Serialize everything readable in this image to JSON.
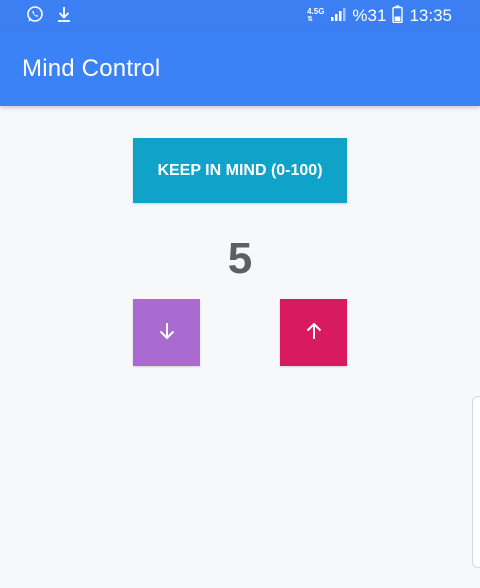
{
  "status_bar": {
    "left_icons": [
      "whatsapp-icon",
      "download-icon"
    ],
    "network_type": "4.5G",
    "battery_text": "%31",
    "time": "13:35"
  },
  "app_bar": {
    "title": "Mind Control",
    "color": "#3b82f6"
  },
  "main": {
    "keep_button_label": "KEEP IN MIND (0-100)",
    "keep_button_color": "#0fa3c9",
    "value": "5",
    "down_button": {
      "icon": "arrow-down-icon",
      "color": "#aa6bd0"
    },
    "up_button": {
      "icon": "arrow-up-icon",
      "color": "#d81b60"
    }
  }
}
